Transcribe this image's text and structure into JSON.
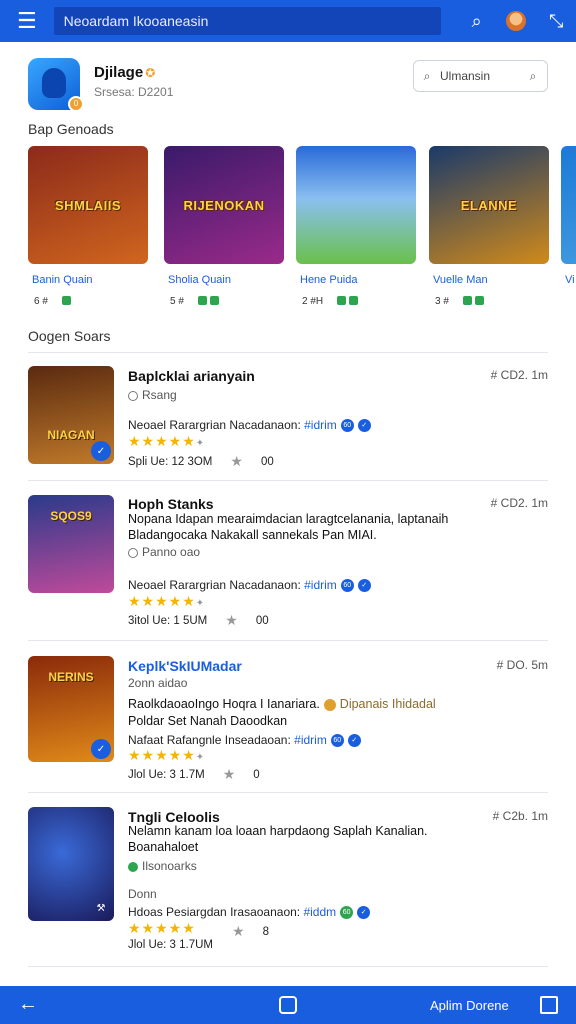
{
  "topbar": {
    "menu_icon": "hamburger-icon",
    "search_text": "Neoardam Ikooaneasin",
    "icons": [
      "search-icon",
      "avatar",
      "collapse-icon"
    ]
  },
  "app": {
    "name": "Djilage",
    "sub": "Srsesa:  D2201",
    "search_label": "Ulmansin"
  },
  "sections": {
    "featured": "Bap Genoads",
    "list": "Oogen Soars"
  },
  "carousel": [
    {
      "art": "SHMLAIIS",
      "name": "Banin Quain",
      "n1": "6 #",
      "n2": "0",
      "colors": [
        "#8b2a1a",
        "#d0661e"
      ]
    },
    {
      "art": "RIJENOKAN",
      "name": "Sholia Quain",
      "n1": "5 #",
      "n2": "0 0",
      "colors": [
        "#3a1a6a",
        "#9a2a8a"
      ]
    },
    {
      "art": "",
      "name": "Hene Puida",
      "n1": "2 #H",
      "n2": "0 0",
      "colors": [
        "#2a6ad8",
        "#6ac04a"
      ]
    },
    {
      "art": "ELANNE",
      "name": "Vuelle Man",
      "n1": "3 #",
      "n2": "0 0",
      "colors": [
        "#1a3a6a",
        "#d08a1a"
      ]
    },
    {
      "art": "",
      "name": "Vi",
      "n1": "",
      "n2": "",
      "colors": [
        "#1a7ad8",
        "#4aa0e0"
      ]
    }
  ],
  "rows": [
    {
      "title": "Baplcklai arianyain",
      "time": "# CD2. 1m",
      "sub": "Rsang",
      "dev_prefix": "Neoael Rarargrian Nacadanaon:",
      "dev_link": "#idrim",
      "stars": "★★★★★",
      "stat": "Spli Ue: 12 3OM",
      "stat2": "00",
      "art": "NIAGAN",
      "colors": [
        "#5a2a10",
        "#c07a2a"
      ]
    },
    {
      "title": "Hoph Stanks",
      "time": "# CD2. 1m",
      "desc1": "Nopana Idapan mearaimdacian laragtcelanania, laptanaih",
      "desc2": "Bladangocaka Nakakall sannekals Pan MIAI.",
      "sub": "Panno oao",
      "dev_prefix": "Neoael Rarargrian Nacadanaon:",
      "dev_link": "#idrim",
      "stars": "★★★★★",
      "stat": "3itol Ue: 1 5UM",
      "stat2": "00",
      "art": "SQOS9",
      "colors": [
        "#2a3a8a",
        "#c04a9a"
      ]
    },
    {
      "title": "Keplk'SkIUMadar",
      "time": "# DO. 5m",
      "line1": "2onn aidao",
      "desc1": "RaolkdaoaoIngo Hoqra I Ianariara.",
      "desc1b": "Dipanais Ihidadal",
      "desc2": "Poldar Set Nanah Daoodkan",
      "dev_prefix": "Nafaat Rafangnle Inseadaoan:",
      "dev_link": "#idrim",
      "stars": "★★★★★",
      "stat": "Jlol Ue: 3 1.7M",
      "stat2": "0",
      "art": "NERINS",
      "colors": [
        "#8a2a0a",
        "#e08a1a"
      ]
    },
    {
      "title": "Tngli Celoolis",
      "time": "# C2b. 1m",
      "desc1": "Nelamn kanam loa loaan harpdaong Saplah Kanalian.",
      "desc2": "Boanahaloet",
      "sub": "Ilsonoarks",
      "line1": "Donn",
      "dev_prefix": "Hdoas Pesiargdan Irasaoanaon:",
      "dev_link": "#iddm",
      "stars": "★★★★★",
      "stat": "Jlol Ue: 3 1.7UM",
      "stat2": "8",
      "art": "",
      "colors": [
        "#1a1a5a",
        "#3a6ad8"
      ]
    }
  ],
  "navbar": {
    "label": "Aplim Dorene"
  }
}
